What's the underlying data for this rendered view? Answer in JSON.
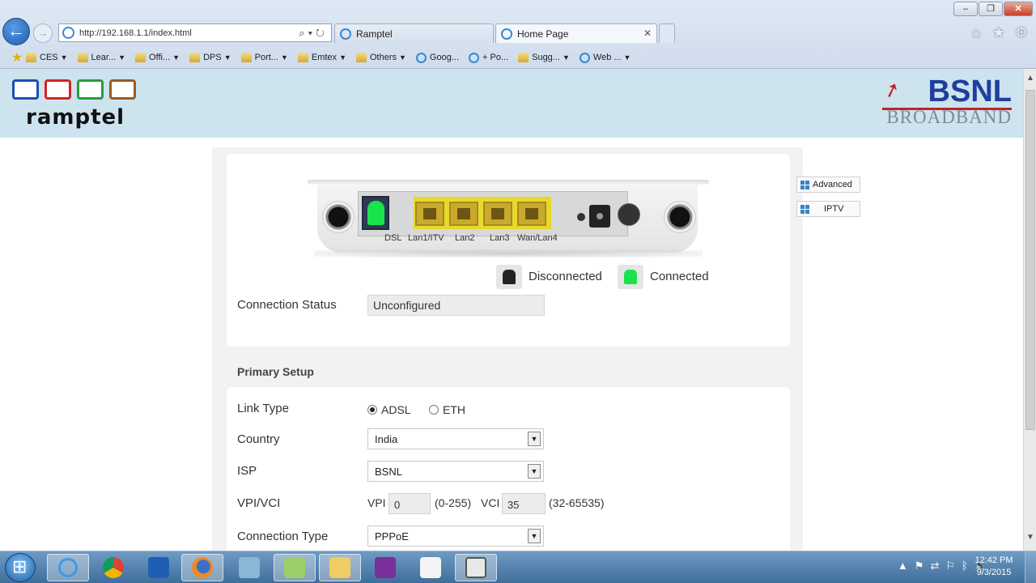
{
  "browser": {
    "url": "http://192.168.1.1/index.html",
    "tabs": [
      {
        "label": "Ramptel"
      },
      {
        "label": "Home Page"
      }
    ],
    "favorites": [
      {
        "label": "CES",
        "type": "folder"
      },
      {
        "label": "Lear...",
        "type": "folder"
      },
      {
        "label": "Offi...",
        "type": "folder"
      },
      {
        "label": "DPS",
        "type": "folder"
      },
      {
        "label": "Port...",
        "type": "folder"
      },
      {
        "label": "Emtex",
        "type": "folder"
      },
      {
        "label": "Others",
        "type": "folder"
      },
      {
        "label": "Goog...",
        "type": "web"
      },
      {
        "label": "+ Po...",
        "type": "web"
      },
      {
        "label": "Sugg...",
        "type": "web"
      },
      {
        "label": "Web ...",
        "type": "web"
      }
    ]
  },
  "header": {
    "left_logo": "ramptel",
    "right_logo_main": "BSNL",
    "right_logo_sub": "BROADBAND"
  },
  "router": {
    "ports": [
      "DSL",
      "Lan1/ITV",
      "Lan2",
      "Lan3",
      "Wan/Lan4"
    ],
    "legend": {
      "disconnected": "Disconnected",
      "connected": "Connected"
    },
    "colors": {
      "connected": "#19e34b",
      "disconnected": "#222222",
      "lan": "#e7d92c"
    }
  },
  "status": {
    "label": "Connection Status",
    "value": "Unconfigured"
  },
  "side_buttons": {
    "advanced": "Advanced",
    "iptv": "IPTV"
  },
  "primary_setup": {
    "title": "Primary Setup",
    "link_type": {
      "label": "Link Type",
      "options": [
        "ADSL",
        "ETH"
      ],
      "selected": "ADSL"
    },
    "country": {
      "label": "Country",
      "value": "India"
    },
    "isp": {
      "label": "ISP",
      "value": "BSNL"
    },
    "vpi_vci": {
      "label": "VPI/VCI",
      "vpi_label": "VPI",
      "vpi_value": "0",
      "vpi_range": "(0-255)",
      "vci_label": "VCI",
      "vci_value": "35",
      "vci_range": "(32-65535)"
    },
    "connection_type": {
      "label": "Connection Type",
      "value": "PPPoE"
    }
  },
  "taskbar": {
    "time": "12:42 PM",
    "date": "9/3/2015"
  }
}
